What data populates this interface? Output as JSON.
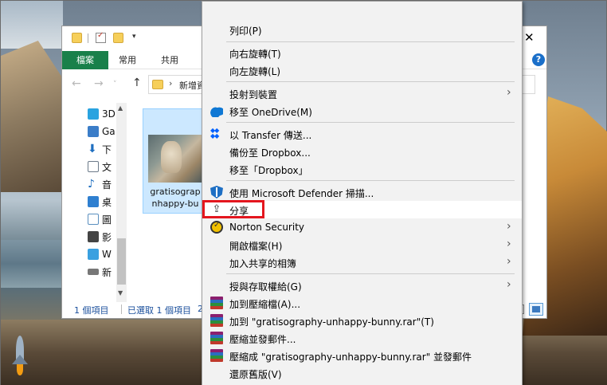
{
  "explorer": {
    "tabs": {
      "file": "檔案",
      "home": "常用",
      "share": "共用"
    },
    "address_text": "新增資",
    "nav_items": [
      {
        "label": "3D",
        "icon": "cube-3d-icon",
        "color": "#29a3e0"
      },
      {
        "label": "Ga",
        "icon": "pc-icon",
        "color": "#3b7dc8"
      },
      {
        "label": "下",
        "icon": "download-icon",
        "color": "#1f6fc0"
      },
      {
        "label": "文",
        "icon": "document-icon",
        "color": "#6c7a89"
      },
      {
        "label": "音",
        "icon": "music-icon",
        "color": "#1f6fc0"
      },
      {
        "label": "桌",
        "icon": "desktop-icon",
        "color": "#2f7fd0"
      },
      {
        "label": "圖",
        "icon": "picture-icon",
        "color": "#5a8fbf"
      },
      {
        "label": "影",
        "icon": "video-icon",
        "color": "#444"
      },
      {
        "label": "W",
        "icon": "drive-windows-icon",
        "color": "#3aa0e0"
      },
      {
        "label": "新",
        "icon": "drive-icon",
        "color": "#777"
      }
    ],
    "file_name_line1": "gratisograp",
    "file_name_line2": "nhappy-bu",
    "status_count": "1 個項目",
    "status_selected": "已選取 1 個項目",
    "status_more": "2"
  },
  "context_menu": {
    "items": [
      {
        "label": "列印(P)",
        "icon": "none",
        "submenu": false
      },
      {
        "label": "向右旋轉(T)",
        "icon": "none",
        "submenu": false
      },
      {
        "label": "向左旋轉(L)",
        "icon": "none",
        "submenu": false
      },
      {
        "label": "投射到裝置",
        "icon": "none",
        "submenu": true
      },
      {
        "label": "移至 OneDrive(M)",
        "icon": "onedrive-icon",
        "submenu": false
      },
      {
        "label": "以 Transfer 傳送...",
        "icon": "dropbox-icon",
        "submenu": false
      },
      {
        "label": "備份至 Dropbox...",
        "icon": "none",
        "submenu": false
      },
      {
        "label": "移至「Dropbox」",
        "icon": "none",
        "submenu": false
      },
      {
        "label": "使用 Microsoft Defender 掃描...",
        "icon": "defender-shield-icon",
        "submenu": false
      },
      {
        "label": "分享",
        "icon": "share-icon",
        "submenu": false,
        "highlighted": true
      },
      {
        "label": "Norton Security",
        "icon": "norton-icon",
        "submenu": true
      },
      {
        "label": "開啟檔案(H)",
        "icon": "none",
        "submenu": true
      },
      {
        "label": "加入共享的相簿",
        "icon": "none",
        "submenu": true
      },
      {
        "label": "授與存取權給(G)",
        "icon": "none",
        "submenu": true
      },
      {
        "label": "加到壓縮檔(A)...",
        "icon": "winrar-icon",
        "submenu": false
      },
      {
        "label": "加到 \"gratisography-unhappy-bunny.rar\"(T)",
        "icon": "winrar-icon",
        "submenu": false
      },
      {
        "label": "壓縮並發郵件...",
        "icon": "winrar-icon",
        "submenu": false
      },
      {
        "label": "壓縮成 \"gratisography-unhappy-bunny.rar\" 並發郵件",
        "icon": "winrar-icon",
        "submenu": false
      },
      {
        "label": "還原舊版(V)",
        "icon": "none",
        "submenu": false
      }
    ],
    "highlight_color": "#e4161e"
  }
}
